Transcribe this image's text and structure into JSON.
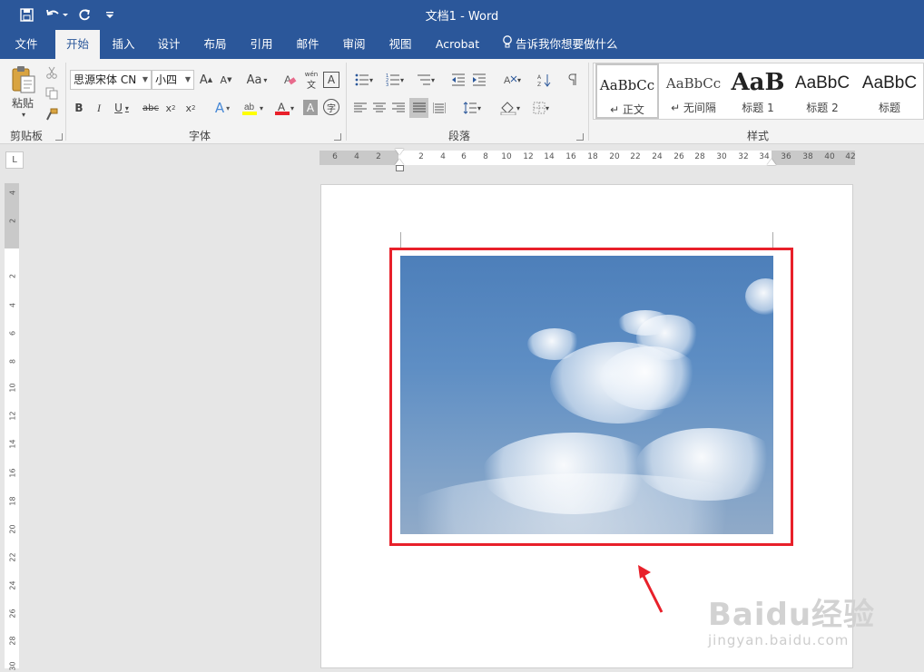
{
  "app": {
    "title": "文档1  -  Word"
  },
  "tabs": [
    {
      "label": "文件"
    },
    {
      "label": "开始"
    },
    {
      "label": "插入"
    },
    {
      "label": "设计"
    },
    {
      "label": "布局"
    },
    {
      "label": "引用"
    },
    {
      "label": "邮件"
    },
    {
      "label": "审阅"
    },
    {
      "label": "视图"
    },
    {
      "label": "Acrobat"
    }
  ],
  "tellme": "告诉我你想要做什么",
  "clipboard": {
    "paste_label": "粘贴",
    "group_label": "剪贴板"
  },
  "font": {
    "name": "思源宋体 CN",
    "size": "小四",
    "group_label": "字体",
    "aa_label": "Aa"
  },
  "paragraph": {
    "group_label": "段落"
  },
  "styles": {
    "group_label": "样式",
    "items": [
      {
        "preview": "AaBbCc",
        "name": "↵ 正文"
      },
      {
        "preview": "AaBbCc",
        "name": "↵ 无间隔"
      },
      {
        "preview": "AaB",
        "name": "标题 1"
      },
      {
        "preview": "AaBbC",
        "name": "标题 2"
      },
      {
        "preview": "AaBbC",
        "name": "标题"
      }
    ]
  },
  "ruler": {
    "corner": "L",
    "h_ticks": [
      "6",
      "4",
      "2",
      "2",
      "4",
      "6",
      "8",
      "10",
      "12",
      "14",
      "16",
      "18",
      "20",
      "22",
      "24",
      "26",
      "28",
      "30",
      "32",
      "34",
      "36",
      "38",
      "40",
      "42"
    ],
    "v_ticks": [
      "4",
      "2",
      "2",
      "4",
      "6",
      "8",
      "10",
      "12",
      "14",
      "16",
      "18",
      "20",
      "22",
      "24",
      "26",
      "28",
      "30"
    ]
  },
  "watermark": {
    "brand": "Baidu经验",
    "url": "jingyan.baidu.com"
  },
  "colors": {
    "accent": "#2b579a",
    "highlight": "#e8202a",
    "font_color_bar": "#e8202a",
    "highlight_bar": "#ffff00"
  }
}
